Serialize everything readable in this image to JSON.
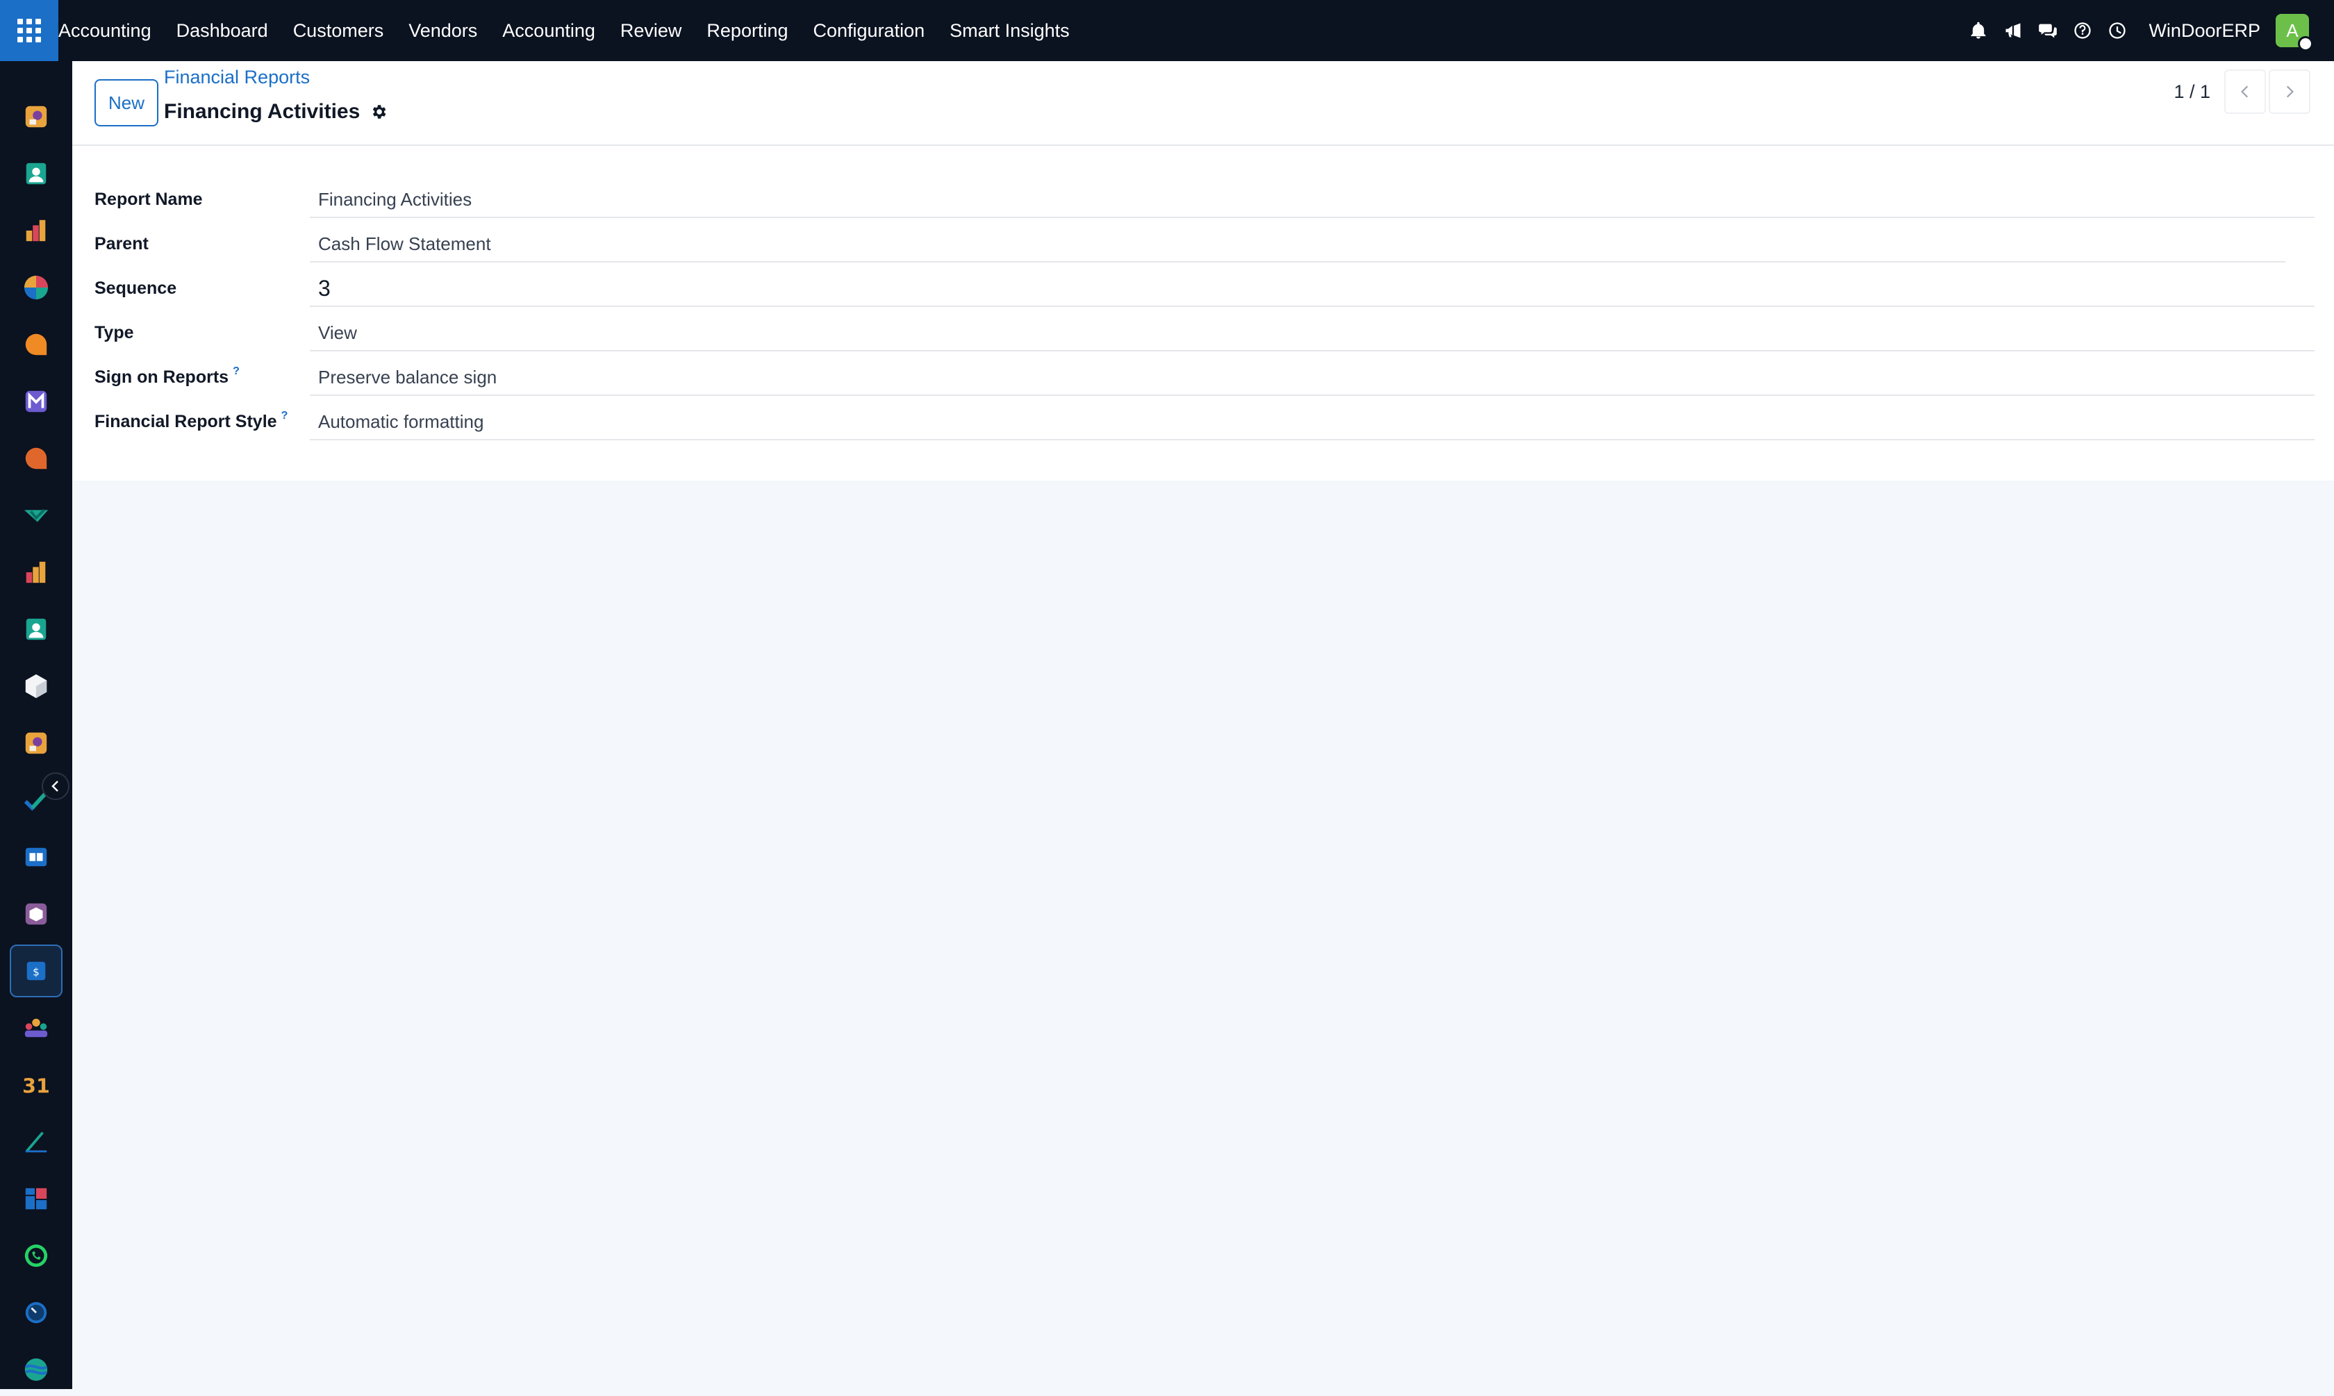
{
  "navbar": {
    "app_name": "Accounting",
    "menu": [
      "Dashboard",
      "Customers",
      "Vendors",
      "Accounting",
      "Review",
      "Reporting",
      "Configuration",
      "Smart Insights"
    ],
    "company": "WinDoorERP",
    "avatar_letter": "A",
    "icons": [
      "bell-icon",
      "megaphone-icon",
      "chat-icon",
      "help-icon",
      "clock-icon"
    ]
  },
  "sidebar": {
    "apps": [
      "discuss-icon",
      "contacts-icon",
      "reports-icon",
      "dashboards-icon",
      "discuss-bubble-icon",
      "mail-icon",
      "livechat-icon",
      "sign-icon",
      "analytics-icon",
      "employees-icon",
      "inventory-icon",
      "projects-icon",
      "todo-icon",
      "knowledge-icon",
      "packages-icon",
      "accounting-icon",
      "crm-icon",
      "calendar-icon",
      "documents-icon",
      "apps-icon",
      "whatsapp-icon",
      "timesheet-icon",
      "website-icon"
    ],
    "active_app": "accounting-icon",
    "calendar_day": "31"
  },
  "control_panel": {
    "new_label": "New",
    "breadcrumb_parent": "Financial Reports",
    "record_title": "Financing Activities",
    "pager_value": "1 / 1"
  },
  "form": {
    "fields": [
      {
        "label": "Report Name",
        "value": "Financing Activities",
        "help": false
      },
      {
        "label": "Parent",
        "value": "Cash Flow Statement",
        "help": false
      },
      {
        "label": "Sequence",
        "value": "3",
        "help": false
      },
      {
        "label": "Type",
        "value": "View",
        "help": false
      },
      {
        "label": "Sign on Reports",
        "value": "Preserve balance sign",
        "help": true
      },
      {
        "label": "Financial Report Style",
        "value": "Automatic formatting",
        "help": true
      }
    ],
    "help_mark": "?"
  },
  "colors": {
    "navbar_bg": "#0b1220",
    "accent": "#1b6fc7",
    "page_bg": "#f4f7fb",
    "avatar": "#6cc04a"
  }
}
